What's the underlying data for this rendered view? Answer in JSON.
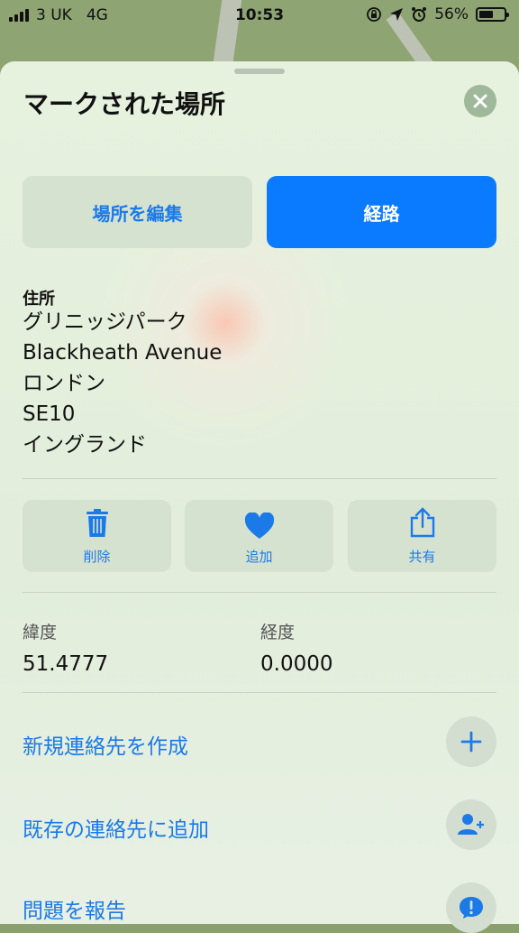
{
  "status_bar": {
    "carrier": "3 UK",
    "network": "4G",
    "time": "10:53",
    "battery": "56%",
    "battery_level": 0.56
  },
  "sheet": {
    "title": "マークされた場所",
    "buttons": {
      "edit_label": "場所を編集",
      "route_label": "経路"
    },
    "address": {
      "header": "住所",
      "lines": [
        "グリニッジパーク",
        "Blackheath Avenue",
        "ロンドン",
        "SE10",
        "イングランド"
      ]
    },
    "actions": [
      {
        "label": "削除",
        "icon": "trash-icon"
      },
      {
        "label": "追加",
        "icon": "heart-icon"
      },
      {
        "label": "共有",
        "icon": "share-icon"
      }
    ],
    "coordinates": {
      "latitude_label": "緯度",
      "latitude_value": "51.4777",
      "longitude_label": "経度",
      "longitude_value": "0.0000"
    },
    "links": [
      {
        "label": "新規連絡先を作成",
        "icon": "plus-icon"
      },
      {
        "label": "既存の連絡先に追加",
        "icon": "add-contact-icon"
      },
      {
        "label": "問題を報告",
        "icon": "report-icon"
      }
    ]
  },
  "colors": {
    "accent": "#0a7bff",
    "link": "#1b7ae8",
    "sheet_background": "#e4f0dc",
    "button_background": "#d6e2d0"
  }
}
